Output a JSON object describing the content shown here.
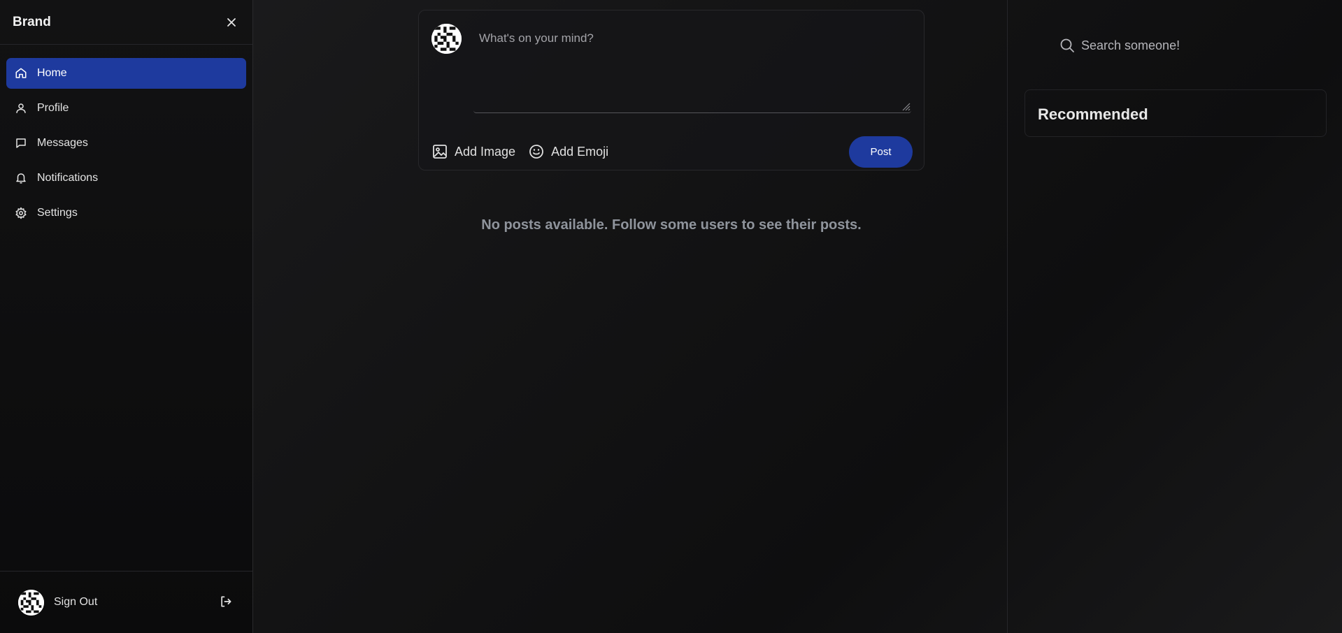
{
  "sidebar": {
    "brand": "Brand",
    "items": [
      {
        "label": "Home",
        "icon": "home-icon",
        "active": true
      },
      {
        "label": "Profile",
        "icon": "user-icon",
        "active": false
      },
      {
        "label": "Messages",
        "icon": "message-icon",
        "active": false
      },
      {
        "label": "Notifications",
        "icon": "bell-icon",
        "active": false
      },
      {
        "label": "Settings",
        "icon": "gear-icon",
        "active": false
      }
    ],
    "footer": {
      "signout_label": "Sign Out"
    }
  },
  "composer": {
    "placeholder": "What's on your mind?",
    "add_image_label": "Add Image",
    "add_emoji_label": "Add Emoji",
    "post_label": "Post"
  },
  "feed": {
    "empty_message": "No posts available. Follow some users to see their posts."
  },
  "right": {
    "search_placeholder": "Search someone!",
    "recommended_title": "Recommended"
  },
  "colors": {
    "accent": "#1e3a9e",
    "background": "#141415"
  }
}
